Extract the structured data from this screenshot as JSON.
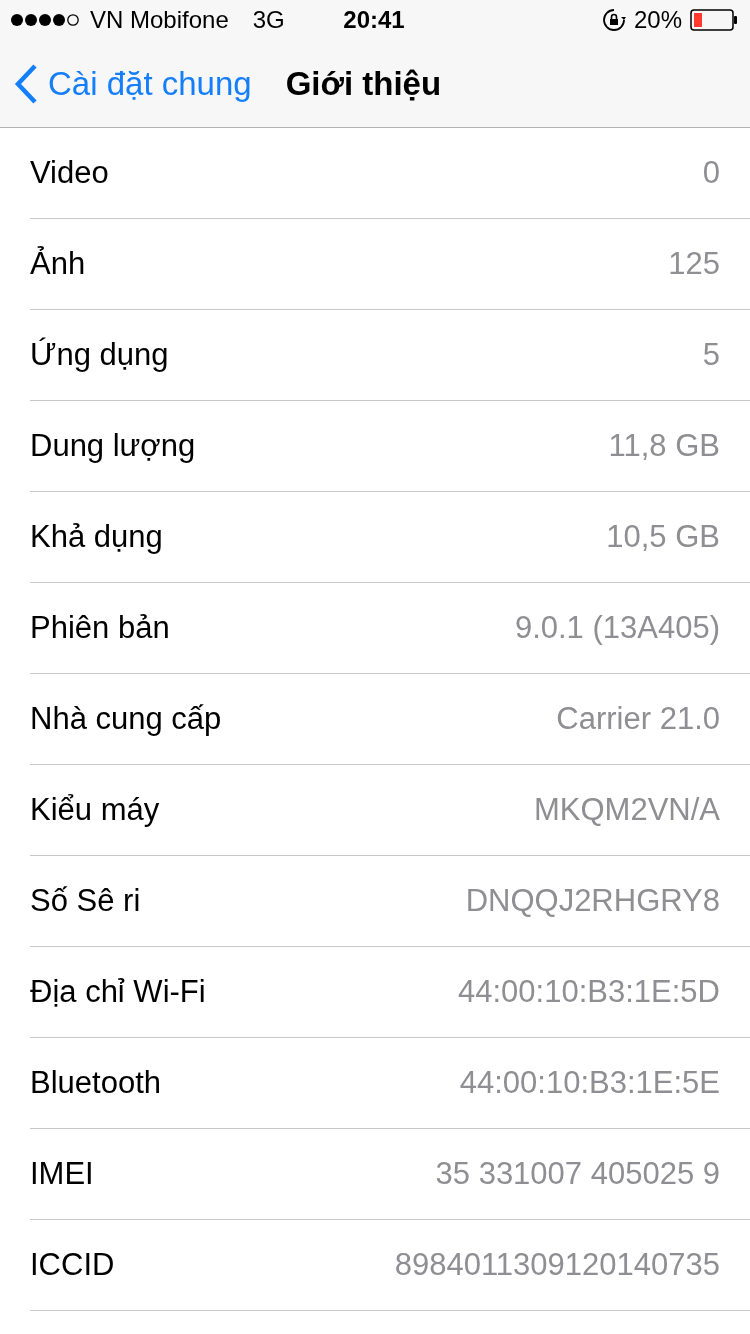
{
  "status_bar": {
    "carrier": "VN Mobifone",
    "network": "3G",
    "time": "20:41",
    "battery": "20%"
  },
  "nav": {
    "back": "Cài đặt chung",
    "title": "Giới thiệu"
  },
  "rows": [
    {
      "label": "Video",
      "value": "0"
    },
    {
      "label": "Ảnh",
      "value": "125"
    },
    {
      "label": "Ứng dụng",
      "value": "5"
    },
    {
      "label": "Dung lượng",
      "value": "11,8 GB"
    },
    {
      "label": "Khả dụng",
      "value": "10,5 GB"
    },
    {
      "label": "Phiên bản",
      "value": "9.0.1 (13A405)"
    },
    {
      "label": "Nhà cung cấp",
      "value": "Carrier 21.0"
    },
    {
      "label": "Kiểu máy",
      "value": "MKQM2VN/A"
    },
    {
      "label": "Số Sê ri",
      "value": "DNQQJ2RHGRY8"
    },
    {
      "label": "Địa chỉ Wi-Fi",
      "value": "44:00:10:B3:1E:5D"
    },
    {
      "label": "Bluetooth",
      "value": "44:00:10:B3:1E:5E"
    },
    {
      "label": "IMEI",
      "value": "35 331007 405025 9"
    },
    {
      "label": "ICCID",
      "value": "8984011309120140735"
    }
  ]
}
